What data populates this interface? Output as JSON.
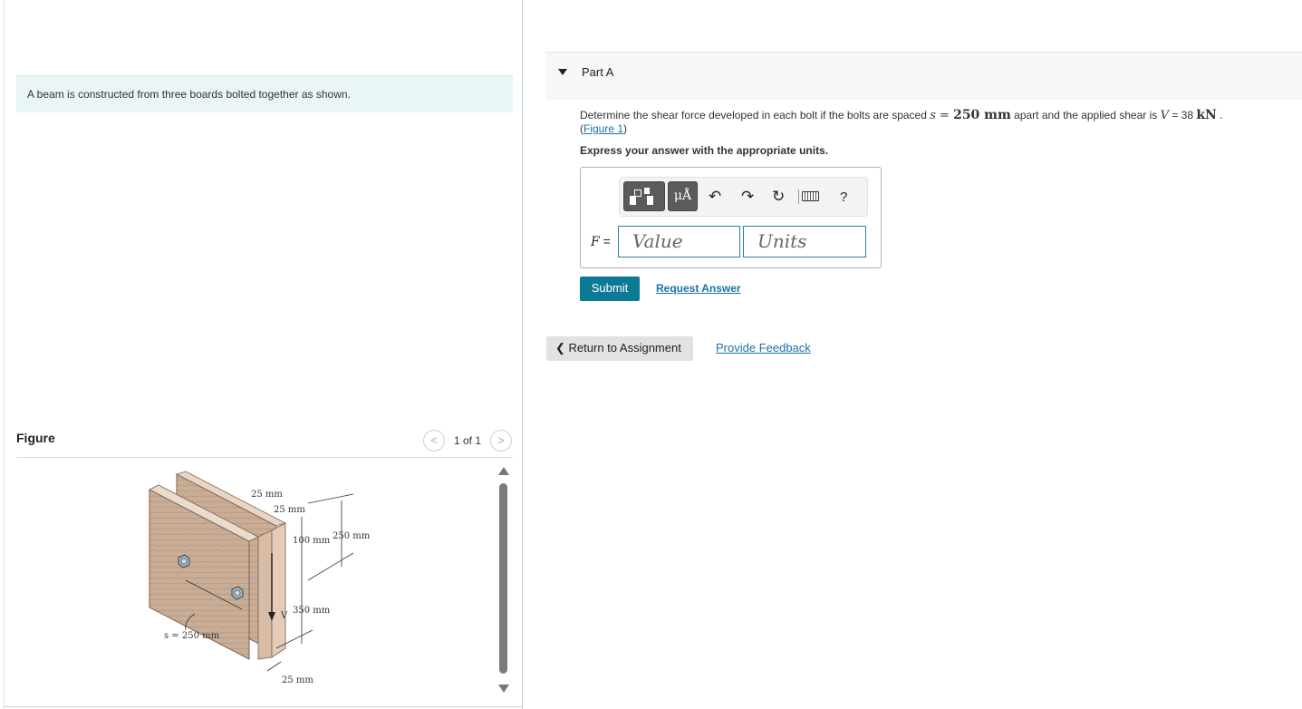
{
  "left": {
    "intro_text": "A beam is constructed from three boards bolted together as shown.",
    "figure_title": "Figure",
    "figure_counter": "1 of 1",
    "figure_labels": {
      "dim_25a": "25 mm",
      "dim_25b": "25 mm",
      "dim_100": "100 mm",
      "dim_250": "250 mm",
      "dim_350": "350 mm",
      "dim_25c": "25 mm",
      "shear": "V",
      "spacing": "s = 250 mm"
    }
  },
  "part": {
    "title": "Part A",
    "q_pre": "Determine the shear force developed in each bolt if the bolts are spaced ",
    "q_s_var": "s",
    "q_s_eq": " = ",
    "q_s_val": "250 mm",
    "q_mid": " apart and the applied shear is ",
    "q_v_var": "V",
    "q_v_eq": " = 38 ",
    "q_v_unit": "kN",
    "q_end": " .",
    "fig_link_open": "(",
    "fig_link": "Figure 1",
    "fig_link_close": ")",
    "express": "Express your answer with the appropriate units.",
    "toolbar": {
      "units_btn": "μÅ",
      "undo": "↶",
      "redo": "↷",
      "reset": "↻",
      "help": "?"
    },
    "answer_label_var": "F",
    "answer_label_eq": " =",
    "value_placeholder": "Value",
    "units_placeholder": "Units",
    "submit": "Submit",
    "request_answer": "Request Answer"
  },
  "footer": {
    "return": "Return to Assignment",
    "return_icon": "chevron-left-icon",
    "feedback": "Provide Feedback"
  },
  "colors": {
    "accent": "#0d7a95",
    "link": "#1a73a8",
    "intro_bg": "#e9f5f7"
  }
}
